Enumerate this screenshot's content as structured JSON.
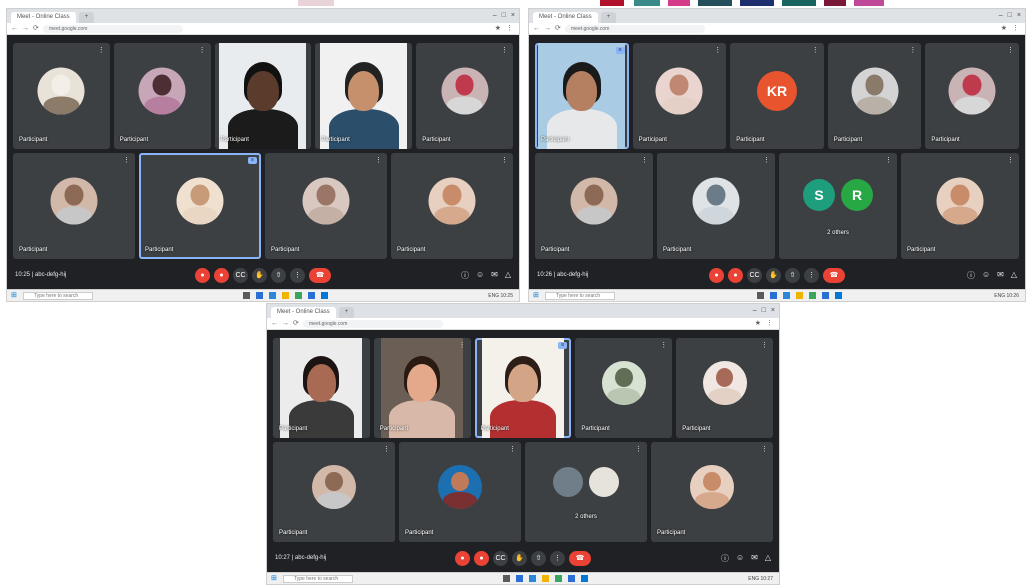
{
  "strip_colors": [
    "#ffffff",
    "#ffffff",
    "#ffffff",
    "#e8d3d8",
    "#ffffff",
    "#ffffff",
    "#ffffff",
    "#b0102a",
    "#ffffff",
    "#3a8a8a",
    "#ffffff",
    "#d43b8a",
    "#ffffff",
    "#244e5a",
    "#ffffff",
    "#1c2e6e",
    "#ffffff",
    "#18645e",
    "#ffffff",
    "#7a1838",
    "#ffffff",
    "#c04a9a",
    "#ffffff"
  ],
  "screens": [
    {
      "browser": {
        "tab_label": "Meet - Online Class",
        "new_tab": "+",
        "url": "meet.google.com",
        "ctrl_min": "–",
        "ctrl_max": "□",
        "ctrl_close": "×"
      },
      "rows": [
        [
          {
            "name": "Participant",
            "kind": "avatar",
            "avatar_color": "#e9e2d8",
            "head_color": "#f3efe8",
            "body_color": "#8d7b6a"
          },
          {
            "name": "Participant",
            "kind": "avatar",
            "avatar_color": "#c7a7b7",
            "head_color": "#4b2f34",
            "body_color": "#b67fa0"
          },
          {
            "name": "Participant",
            "kind": "video",
            "bg": "#e9ecef",
            "skin": "#5a3b2c",
            "hair": "#111111",
            "shirt": "#1b1b1b"
          },
          {
            "name": "Participant",
            "kind": "video",
            "bg": "#f1f1f1",
            "skin": "#c7906d",
            "hair": "#222222",
            "shirt": "#2b4e6b"
          },
          {
            "name": "Participant",
            "kind": "avatar",
            "avatar_color": "#c9b3b5",
            "head_color": "#c03a4e",
            "body_color": "#d7d7d7"
          }
        ],
        [
          {
            "name": "Participant",
            "kind": "avatar",
            "avatar_color": "#d2b8a8",
            "head_color": "#8c6a55",
            "body_color": "#c7c7c7"
          },
          {
            "name": "Participant",
            "kind": "avatar",
            "avatar_color": "#f0e0d0",
            "head_color": "#c79a78",
            "body_color": "#e9d6c3",
            "speaking": true
          },
          {
            "name": "Participant",
            "kind": "avatar",
            "avatar_color": "#d8c8c0",
            "head_color": "#9b7565",
            "body_color": "#c5b0a6"
          },
          {
            "name": "Participant",
            "kind": "avatar",
            "avatar_color": "#e8d0c0",
            "head_color": "#c98c6a",
            "body_color": "#d7a98c"
          }
        ]
      ],
      "controls": {
        "time": "10:25  | abc-defg-hij",
        "mic": "●",
        "cam": "●",
        "cc": "CC",
        "hand": "✋",
        "present": "⇧",
        "more": "⋮",
        "end": "☎",
        "info": "ⓘ",
        "people": "☺",
        "chat": "✉",
        "activities": "△"
      },
      "taskbar": {
        "start": "⊞",
        "search": "Type here to search",
        "tray": "ENG  10:25"
      }
    },
    {
      "browser": {
        "tab_label": "Meet - Online Class",
        "new_tab": "+",
        "url": "meet.google.com",
        "ctrl_min": "–",
        "ctrl_max": "□",
        "ctrl_close": "×"
      },
      "rows": [
        [
          {
            "name": "Participant",
            "kind": "video",
            "bg": "#a9cbe3",
            "skin": "#b58062",
            "hair": "#1a1a1a",
            "shirt": "#e6e8ea",
            "speaking": true
          },
          {
            "name": "Participant",
            "kind": "avatar",
            "avatar_color": "#e9d4cf",
            "head_color": "#c08872",
            "body_color": "#e5d0c8"
          },
          {
            "name": "Participant",
            "kind": "letter",
            "avatar_color": "#e8542e",
            "letter": "KR"
          },
          {
            "name": "Participant",
            "kind": "avatar",
            "avatar_color": "#d4d4d4",
            "head_color": "#8a7a6a",
            "body_color": "#b9b0a8"
          },
          {
            "name": "Participant",
            "kind": "avatar",
            "avatar_color": "#c9b3b5",
            "head_color": "#c03a4e",
            "body_color": "#d7d7d7"
          }
        ],
        [
          {
            "name": "Participant",
            "kind": "avatar",
            "avatar_color": "#d2b8a8",
            "head_color": "#8c6a55",
            "body_color": "#c7c7c7"
          },
          {
            "name": "Participant",
            "kind": "avatar",
            "avatar_color": "#dfe3e6",
            "head_color": "#6b7c88",
            "body_color": "#cfd6dc"
          },
          {
            "name": "Participant",
            "kind": "pair",
            "avatar_color": "#1f9e7d",
            "avatar_color2": "#27a844",
            "letter": "S",
            "letter2": "R",
            "sub": "2 others"
          },
          {
            "name": "Participant",
            "kind": "avatar",
            "avatar_color": "#e8d0c0",
            "head_color": "#c98c6a",
            "body_color": "#d7a98c"
          }
        ]
      ],
      "controls": {
        "time": "10:26  | abc-defg-hij",
        "mic": "●",
        "cam": "●",
        "cc": "CC",
        "hand": "✋",
        "present": "⇧",
        "more": "⋮",
        "end": "☎",
        "info": "ⓘ",
        "people": "☺",
        "chat": "✉",
        "activities": "△"
      },
      "taskbar": {
        "start": "⊞",
        "search": "Type here to search",
        "tray": "ENG  10:26"
      }
    },
    {
      "browser": {
        "tab_label": "Meet - Online Class",
        "new_tab": "+",
        "url": "meet.google.com",
        "ctrl_min": "–",
        "ctrl_max": "□",
        "ctrl_close": "×"
      },
      "rows": [
        [
          {
            "name": "Participant",
            "kind": "video",
            "bg": "#ececec",
            "skin": "#a86a52",
            "hair": "#1c1412",
            "shirt": "#3a3a3a"
          },
          {
            "name": "Participant",
            "kind": "video",
            "bg": "#6b5e55",
            "skin": "#e3a98a",
            "hair": "#2a1a12",
            "shirt": "#d8b8a8"
          },
          {
            "name": "Participant",
            "kind": "video",
            "bg": "#f4f0ea",
            "skin": "#d4a486",
            "hair": "#2c1d16",
            "shirt": "#b43030",
            "speaking": true
          },
          {
            "name": "Participant",
            "kind": "avatar",
            "avatar_color": "#d7e2d2",
            "head_color": "#5f6e55",
            "body_color": "#b9c6b1"
          },
          {
            "name": "Participant",
            "kind": "avatar",
            "avatar_color": "#f1e7e2",
            "head_color": "#a76a58",
            "body_color": "#e3d1c6"
          }
        ],
        [
          {
            "name": "Participant",
            "kind": "avatar",
            "avatar_color": "#d2b8a8",
            "head_color": "#8c6a55",
            "body_color": "#c7c7c7"
          },
          {
            "name": "Participant",
            "kind": "avatar",
            "avatar_color": "#1c6fb0",
            "head_color": "#c07a5a",
            "body_color": "#7a3030"
          },
          {
            "name": "Participant",
            "kind": "pair2",
            "avatar_color": "#6f7e88",
            "avatar_color2": "#e6e2dc",
            "sub": "2 others"
          },
          {
            "name": "Participant",
            "kind": "avatar",
            "avatar_color": "#e8d0c0",
            "head_color": "#c98c6a",
            "body_color": "#d7a98c"
          }
        ]
      ],
      "controls": {
        "time": "10:27  | abc-defg-hij",
        "mic": "●",
        "cam": "●",
        "cc": "CC",
        "hand": "✋",
        "present": "⇧",
        "more": "⋮",
        "end": "☎",
        "info": "ⓘ",
        "people": "☺",
        "chat": "✉",
        "activities": "△"
      },
      "taskbar": {
        "start": "⊞",
        "search": "Type here to search",
        "tray": "ENG  10:27"
      }
    }
  ]
}
